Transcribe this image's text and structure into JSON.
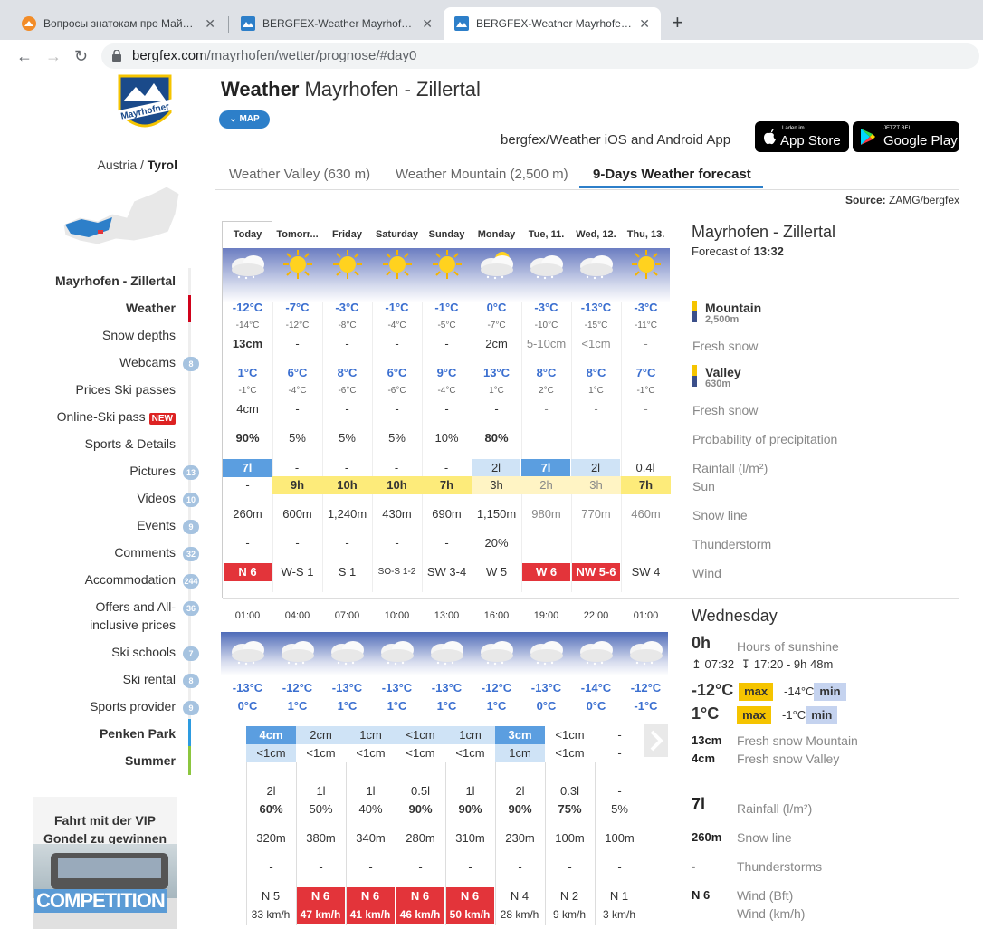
{
  "browser": {
    "tabs": [
      {
        "title": "Вопросы знатокам про Майрхофен",
        "active": false
      },
      {
        "title": "BERGFEX-Weather Mayrhofen - Zillertal",
        "active": false
      },
      {
        "title": "BERGFEX-Weather Mayrhofen - Zillertal",
        "active": true
      }
    ],
    "url_host": "bergfex.com",
    "url_path": "/mayrhofen/wetter/prognose/#day0"
  },
  "sidebar": {
    "logo_text": "Mayrhofner",
    "country": "Austria",
    "separator": "/",
    "state": "Tyrol",
    "menu": [
      {
        "label": "Mayrhofen - Zillertal",
        "bold": true,
        "badge": ""
      },
      {
        "label": "Weather",
        "bold": true,
        "badge": ""
      },
      {
        "label": "Snow depths",
        "bold": false,
        "badge": ""
      },
      {
        "label": "Webcams",
        "bold": false,
        "badge": "8"
      },
      {
        "label": "Prices Ski passes",
        "bold": false,
        "badge": ""
      },
      {
        "label": "Online-Ski pass",
        "bold": false,
        "badge": "",
        "tag": "NEW"
      },
      {
        "label": "Sports & Details",
        "bold": false,
        "badge": ""
      },
      {
        "label": "Pictures",
        "bold": false,
        "badge": "13"
      },
      {
        "label": "Videos",
        "bold": false,
        "badge": "10"
      },
      {
        "label": "Events",
        "bold": false,
        "badge": "9"
      },
      {
        "label": "Comments",
        "bold": false,
        "badge": "32"
      },
      {
        "label": "Accommodation",
        "bold": false,
        "badge": "244"
      },
      {
        "label": "Offers and All-",
        "label2": "inclusive prices",
        "bold": false,
        "badge": "36"
      },
      {
        "label": "Ski schools",
        "bold": false,
        "badge": "7"
      },
      {
        "label": "Ski rental",
        "bold": false,
        "badge": "8"
      },
      {
        "label": "Sports provider",
        "bold": false,
        "badge": "9"
      },
      {
        "label": "Penken Park",
        "bold": true,
        "badge": ""
      },
      {
        "label": "Summer",
        "bold": true,
        "badge": ""
      }
    ],
    "ad": {
      "line1": "Fahrt mit der VIP",
      "line2": "Gondel zu gewinnen",
      "banner": "COMPETITION"
    }
  },
  "header": {
    "title_bold": "Weather",
    "title_rest": "Mayrhofen - Zillertal",
    "map_button": "MAP",
    "app_text": "bergfex/Weather iOS and Android App",
    "appstore_small": "Laden im",
    "appstore_big": "App Store",
    "googleplay_small": "JETZT BEI",
    "googleplay_big": "Google Play",
    "tabs": [
      "Weather Valley (630 m)",
      "Weather Mountain (2,500 m)",
      "9-Days Weather forecast"
    ],
    "source_label": "Source:",
    "source_value": "ZAMG/bergfex"
  },
  "forecast": {
    "days": [
      "Today",
      "Tomorr...",
      "Friday",
      "Saturday",
      "Sunday",
      "Monday",
      "Tue, 11.",
      "Wed, 12.",
      "Thu, 13."
    ],
    "mountain_max": [
      "-12°C",
      "-7°C",
      "-3°C",
      "-1°C",
      "-1°C",
      "0°C",
      "-3°C",
      "-13°C",
      "-3°C"
    ],
    "mountain_min": [
      "-14°C",
      "-12°C",
      "-8°C",
      "-4°C",
      "-5°C",
      "-7°C",
      "-10°C",
      "-15°C",
      "-11°C"
    ],
    "mountain_snow": [
      "13cm",
      "-",
      "-",
      "-",
      "-",
      "2cm",
      "5-10cm",
      "<1cm",
      "-"
    ],
    "valley_max": [
      "1°C",
      "6°C",
      "8°C",
      "6°C",
      "9°C",
      "13°C",
      "8°C",
      "8°C",
      "7°C"
    ],
    "valley_min": [
      "-1°C",
      "-4°C",
      "-6°C",
      "-6°C",
      "-4°C",
      "1°C",
      "2°C",
      "1°C",
      "-1°C"
    ],
    "valley_snow": [
      "4cm",
      "-",
      "-",
      "-",
      "-",
      "-",
      "-",
      "-",
      "-"
    ],
    "precip_prob": [
      "90%",
      "5%",
      "5%",
      "5%",
      "10%",
      "80%",
      "",
      "",
      ""
    ],
    "rainfall": [
      "7l",
      "-",
      "-",
      "-",
      "-",
      "2l",
      "7l",
      "2l",
      "0.4l"
    ],
    "sun": [
      "-",
      "9h",
      "10h",
      "10h",
      "7h",
      "3h",
      "2h",
      "3h",
      "7h"
    ],
    "snow_line": [
      "260m",
      "600m",
      "1,240m",
      "430m",
      "690m",
      "1,150m",
      "980m",
      "770m",
      "460m"
    ],
    "thunderstorm": [
      "-",
      "-",
      "-",
      "-",
      "-",
      "20%",
      "",
      "",
      ""
    ],
    "wind": [
      "N 6",
      "W-S 1",
      "S 1",
      "SO-S 1-2",
      "SW 3-4",
      "W 5",
      "W 6",
      "NW 5-6",
      "SW 4"
    ],
    "wind_red": [
      true,
      false,
      false,
      false,
      false,
      false,
      true,
      true,
      false
    ],
    "right": {
      "place": "Mayrhofen - Zillertal",
      "forecast_of": "Forecast of",
      "time": "13:32",
      "mountain_label": "Mountain",
      "mountain_alt": "2,500m",
      "fresh_snow": "Fresh snow",
      "valley_label": "Valley",
      "valley_alt": "630m",
      "fresh_snow2": "Fresh snow",
      "precip": "Probability of precipitation",
      "rainfall": "Rainfall (l/m²)",
      "sun": "Sun",
      "snow_line": "Snow line",
      "thunderstorm": "Thunderstorm",
      "wind": "Wind"
    }
  },
  "hourly": {
    "hours": [
      "01:00",
      "04:00",
      "07:00",
      "10:00",
      "13:00",
      "16:00",
      "19:00",
      "22:00",
      "01:00"
    ],
    "mountain_temp": [
      "-13°C",
      "-12°C",
      "-13°C",
      "-13°C",
      "-13°C",
      "-12°C",
      "-13°C",
      "-14°C",
      "-12°C"
    ],
    "valley_temp": [
      "0°C",
      "1°C",
      "1°C",
      "1°C",
      "1°C",
      "1°C",
      "0°C",
      "0°C",
      "-1°C"
    ],
    "snow_mountain": [
      "4cm",
      "2cm",
      "1cm",
      "<1cm",
      "1cm",
      "3cm",
      "<1cm",
      "-"
    ],
    "snow_valley": [
      "<1cm",
      "<1cm",
      "<1cm",
      "<1cm",
      "<1cm",
      "1cm",
      "<1cm",
      "-"
    ],
    "rain": [
      "2l",
      "1l",
      "1l",
      "0.5l",
      "1l",
      "2l",
      "0.3l",
      "-"
    ],
    "prob": [
      "60%",
      "50%",
      "40%",
      "90%",
      "90%",
      "90%",
      "75%",
      "5%"
    ],
    "snow_line": [
      "320m",
      "380m",
      "340m",
      "280m",
      "310m",
      "230m",
      "100m",
      "100m"
    ],
    "thunder": [
      "-",
      "-",
      "-",
      "-",
      "-",
      "-",
      "-",
      "-"
    ],
    "wind": [
      "N 5",
      "N 6",
      "N 6",
      "N 6",
      "N 6",
      "N 4",
      "N 2",
      "N 1"
    ],
    "wind_kmh": [
      "33 km/h",
      "47 km/h",
      "41 km/h",
      "46 km/h",
      "50 km/h",
      "28 km/h",
      "9 km/h",
      "3 km/h"
    ],
    "wind_red": [
      false,
      true,
      true,
      true,
      true,
      false,
      false,
      false
    ]
  },
  "day_detail": {
    "day": "Wednesday",
    "sun_hours": "0h",
    "sun_hours_label": "Hours of sunshine",
    "sunrise": "07:32",
    "sunset": "17:20 - 9h 48m",
    "mountain_max": "-12°C",
    "mountain_min": "-14°C",
    "valley_max": "1°C",
    "valley_min": "-1°C",
    "max_label": "max",
    "min_label": "min",
    "snow_mountain": "13cm",
    "snow_mountain_label": "Fresh snow Mountain",
    "snow_valley": "4cm",
    "snow_valley_label": "Fresh snow Valley",
    "rain": "7l",
    "rain_label": "Rainfall (l/m²)",
    "snow_line": "260m",
    "snow_line_label": "Snow line",
    "thunder": "-",
    "thunder_label": "Thunderstorms",
    "wind": "N 6",
    "wind_label": "Wind (Bft)",
    "wind_kmh_label": "Wind (km/h)"
  },
  "colors": {
    "accent": "#2d7fc9",
    "temp_blue": "#3b6fd0",
    "wind_red": "#e3343a",
    "sun_yellow": "#fdeb7a"
  }
}
